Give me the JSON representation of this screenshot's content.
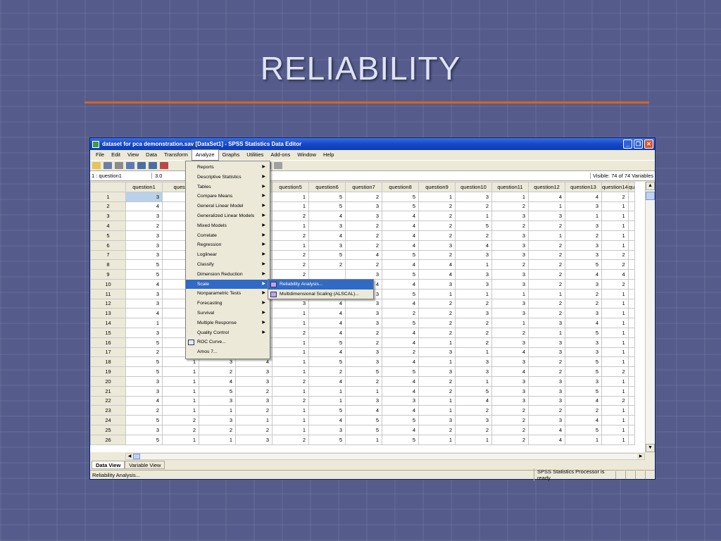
{
  "slide": {
    "title": "RELIABILITY"
  },
  "window": {
    "title": "dataset for pca demonstration.sav [DataSet1] - SPSS Statistics Data Editor",
    "menu": [
      "File",
      "Edit",
      "View",
      "Data",
      "Transform",
      "Analyze",
      "Graphs",
      "Utilities",
      "Add-ons",
      "Window",
      "Help"
    ],
    "cell_ref": "1 : question1",
    "cell_value": "3.0",
    "visible": "Visible: 74 of 74 Variables",
    "columns": [
      "question1",
      "questi",
      "question5",
      "question6",
      "question7",
      "question8",
      "question9",
      "question10",
      "question11",
      "question12",
      "question13",
      "question14",
      "qu"
    ],
    "tabs": [
      "Data View",
      "Variable View"
    ],
    "status_left": "Reliability Analysis...",
    "status_right": "SPSS Statistics  Processor is ready"
  },
  "rows": [
    {
      "n": "1",
      "q1": "3",
      "q2": "",
      "c": [
        "",
        "",
        "1",
        "5",
        "2",
        "5",
        "1",
        "3",
        "1",
        "4",
        "4",
        "2"
      ]
    },
    {
      "n": "2",
      "q1": "4",
      "q2": "",
      "c": [
        "",
        "",
        "1",
        "5",
        "3",
        "5",
        "2",
        "2",
        "2",
        "1",
        "3",
        "1"
      ]
    },
    {
      "n": "3",
      "q1": "3",
      "q2": "",
      "c": [
        "",
        "",
        "2",
        "4",
        "3",
        "4",
        "2",
        "1",
        "3",
        "3",
        "1",
        "1"
      ]
    },
    {
      "n": "4",
      "q1": "2",
      "q2": "",
      "c": [
        "",
        "",
        "1",
        "3",
        "2",
        "4",
        "2",
        "5",
        "2",
        "2",
        "3",
        "1"
      ]
    },
    {
      "n": "5",
      "q1": "3",
      "q2": "",
      "c": [
        "",
        "",
        "2",
        "4",
        "2",
        "4",
        "2",
        "2",
        "3",
        "1",
        "2",
        "1"
      ]
    },
    {
      "n": "6",
      "q1": "3",
      "q2": "",
      "c": [
        "",
        "",
        "1",
        "3",
        "2",
        "4",
        "3",
        "4",
        "3",
        "2",
        "3",
        "1"
      ]
    },
    {
      "n": "7",
      "q1": "3",
      "q2": "",
      "c": [
        "",
        "",
        "2",
        "5",
        "4",
        "5",
        "2",
        "3",
        "3",
        "2",
        "3",
        "2"
      ]
    },
    {
      "n": "8",
      "q1": "5",
      "q2": "",
      "c": [
        "",
        "",
        "2",
        "2",
        "2",
        "4",
        "4",
        "1",
        "2",
        "2",
        "5",
        "2"
      ]
    },
    {
      "n": "9",
      "q1": "5",
      "q2": "",
      "c": [
        "",
        "",
        "2",
        "",
        "3",
        "5",
        "4",
        "3",
        "3",
        "2",
        "4",
        "4"
      ]
    },
    {
      "n": "10",
      "q1": "4",
      "q2": "",
      "c": [
        "",
        "",
        "",
        "",
        "4",
        "4",
        "3",
        "3",
        "3",
        "2",
        "3",
        "2"
      ]
    },
    {
      "n": "11",
      "q1": "3",
      "q2": "",
      "c": [
        "",
        "",
        "",
        "",
        "3",
        "5",
        "1",
        "1",
        "1",
        "1",
        "2",
        "1"
      ]
    },
    {
      "n": "12",
      "q1": "3",
      "q2": "",
      "c": [
        "",
        "",
        "3",
        "4",
        "3",
        "4",
        "2",
        "2",
        "3",
        "2",
        "2",
        "1"
      ]
    },
    {
      "n": "13",
      "q1": "4",
      "q2": "",
      "c": [
        "",
        "",
        "1",
        "4",
        "3",
        "2",
        "2",
        "3",
        "3",
        "2",
        "3",
        "1"
      ]
    },
    {
      "n": "14",
      "q1": "1",
      "q2": "",
      "c": [
        "",
        "",
        "1",
        "4",
        "3",
        "5",
        "2",
        "2",
        "1",
        "3",
        "4",
        "1"
      ]
    },
    {
      "n": "15",
      "q1": "3",
      "q2": "",
      "c": [
        "",
        "",
        "2",
        "4",
        "2",
        "4",
        "2",
        "2",
        "2",
        "1",
        "5",
        "1"
      ]
    },
    {
      "n": "16",
      "q1": "5",
      "q2": "",
      "c": [
        "",
        "",
        "1",
        "5",
        "2",
        "4",
        "1",
        "2",
        "3",
        "3",
        "3",
        "1"
      ]
    },
    {
      "n": "17",
      "q1": "2",
      "q2": "",
      "c": [
        "",
        "",
        "1",
        "4",
        "3",
        "2",
        "3",
        "1",
        "4",
        "3",
        "3",
        "1"
      ]
    },
    {
      "n": "18",
      "q1": "5",
      "q2": "1",
      "c": [
        "3",
        "4",
        "1",
        "5",
        "3",
        "4",
        "1",
        "3",
        "3",
        "2",
        "5",
        "1"
      ]
    },
    {
      "n": "19",
      "q1": "5",
      "q2": "1",
      "c": [
        "2",
        "3",
        "1",
        "2",
        "5",
        "5",
        "3",
        "3",
        "4",
        "2",
        "5",
        "2"
      ]
    },
    {
      "n": "20",
      "q1": "3",
      "q2": "1",
      "c": [
        "4",
        "3",
        "2",
        "4",
        "2",
        "4",
        "2",
        "1",
        "3",
        "3",
        "3",
        "1"
      ]
    },
    {
      "n": "21",
      "q1": "3",
      "q2": "1",
      "c": [
        "5",
        "2",
        "1",
        "1",
        "1",
        "4",
        "2",
        "5",
        "3",
        "3",
        "5",
        "1"
      ]
    },
    {
      "n": "22",
      "q1": "4",
      "q2": "1",
      "c": [
        "3",
        "3",
        "2",
        "1",
        "3",
        "3",
        "1",
        "4",
        "3",
        "3",
        "4",
        "2"
      ]
    },
    {
      "n": "23",
      "q1": "2",
      "q2": "1",
      "c": [
        "1",
        "2",
        "1",
        "5",
        "4",
        "4",
        "1",
        "2",
        "2",
        "2",
        "2",
        "1"
      ]
    },
    {
      "n": "24",
      "q1": "5",
      "q2": "2",
      "c": [
        "3",
        "1",
        "1",
        "4",
        "5",
        "5",
        "3",
        "3",
        "2",
        "3",
        "4",
        "1"
      ]
    },
    {
      "n": "25",
      "q1": "3",
      "q2": "2",
      "c": [
        "2",
        "2",
        "1",
        "3",
        "5",
        "4",
        "2",
        "2",
        "2",
        "4",
        "5",
        "1"
      ]
    },
    {
      "n": "26",
      "q1": "5",
      "q2": "1",
      "c": [
        "1",
        "3",
        "2",
        "5",
        "1",
        "5",
        "1",
        "1",
        "2",
        "4",
        "1",
        "1"
      ]
    }
  ],
  "analyze_menu": [
    {
      "label": "Reports",
      "sub": true
    },
    {
      "label": "Descriptive Statistics",
      "sub": true
    },
    {
      "label": "Tables",
      "sub": true
    },
    {
      "label": "Compare Means",
      "sub": true
    },
    {
      "label": "General Linear Model",
      "sub": true
    },
    {
      "label": "Generalized Linear Models",
      "sub": true
    },
    {
      "label": "Mixed Models",
      "sub": true
    },
    {
      "label": "Correlate",
      "sub": true
    },
    {
      "label": "Regression",
      "sub": true
    },
    {
      "label": "Loglinear",
      "sub": true
    },
    {
      "label": "Classify",
      "sub": true
    },
    {
      "label": "Dimension Reduction",
      "sub": true
    },
    {
      "label": "Scale",
      "sub": true,
      "highlight": true
    },
    {
      "label": "Nonparametric Tests",
      "sub": true
    },
    {
      "label": "Forecasting",
      "sub": true
    },
    {
      "label": "Survival",
      "sub": true
    },
    {
      "label": "Multiple Response",
      "sub": true
    },
    {
      "label": "Quality Control",
      "sub": true
    },
    {
      "label": "ROC Curve...",
      "sub": false,
      "icon": true
    },
    {
      "label": "Amos 7...",
      "sub": false
    }
  ],
  "scale_submenu": [
    {
      "label": "Reliability Analysis...",
      "highlight": true
    },
    {
      "label": "Multidimensional Scaling (ALSCAL)..."
    }
  ]
}
